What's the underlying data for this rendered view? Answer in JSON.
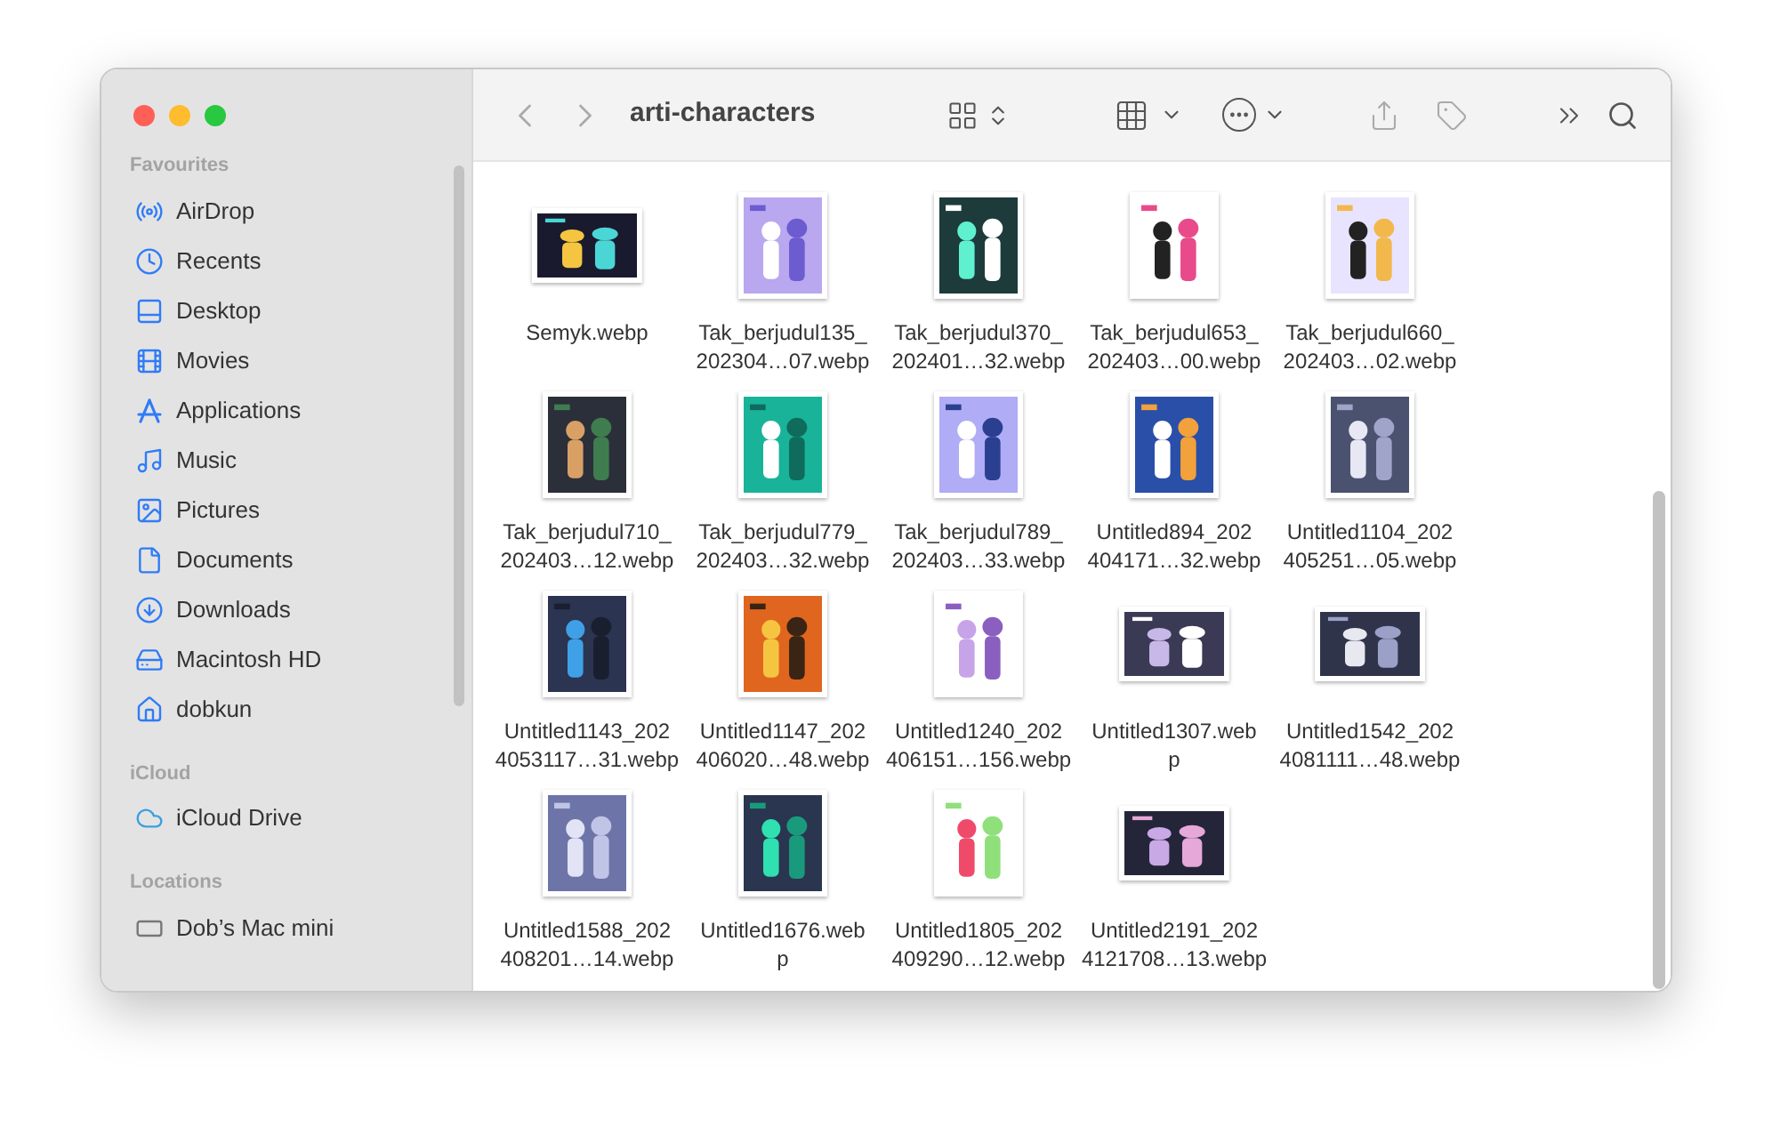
{
  "window": {
    "title": "arti-characters"
  },
  "sidebar": {
    "sections": [
      {
        "heading": "Favourites",
        "items": [
          {
            "label": "AirDrop"
          },
          {
            "label": "Recents"
          },
          {
            "label": "Desktop"
          },
          {
            "label": "Movies"
          },
          {
            "label": "Applications"
          },
          {
            "label": "Music"
          },
          {
            "label": "Pictures"
          },
          {
            "label": "Documents"
          },
          {
            "label": "Downloads"
          },
          {
            "label": "Macintosh HD"
          },
          {
            "label": "dobkun"
          }
        ]
      },
      {
        "heading": "iCloud",
        "items": [
          {
            "label": "iCloud Drive"
          }
        ]
      },
      {
        "heading": "Locations",
        "items": [
          {
            "label": "Dob’s Mac mini"
          }
        ]
      }
    ]
  },
  "files": [
    {
      "lines": [
        "Semyk.webp"
      ]
    },
    {
      "lines": [
        "Tak_berjudul135_",
        "202304…07.webp"
      ]
    },
    {
      "lines": [
        "Tak_berjudul370_",
        "202401…32.webp"
      ]
    },
    {
      "lines": [
        "Tak_berjudul653_",
        "202403…00.webp"
      ]
    },
    {
      "lines": [
        "Tak_berjudul660_",
        "202403…02.webp"
      ]
    },
    {
      "lines": [
        "Tak_berjudul710_",
        "202403…12.webp"
      ]
    },
    {
      "lines": [
        "Tak_berjudul779_",
        "202403…32.webp"
      ]
    },
    {
      "lines": [
        "Tak_berjudul789_",
        "202403…33.webp"
      ]
    },
    {
      "lines": [
        "Untitled894_202",
        "404171…32.webp"
      ]
    },
    {
      "lines": [
        "Untitled1104_202",
        "405251…05.webp"
      ]
    },
    {
      "lines": [
        "Untitled1143_202",
        "4053117…31.webp"
      ]
    },
    {
      "lines": [
        "Untitled1147_202",
        "406020…48.webp"
      ]
    },
    {
      "lines": [
        "Untitled1240_202",
        "406151…156.webp"
      ]
    },
    {
      "lines": [
        "Untitled1307.web",
        "p"
      ]
    },
    {
      "lines": [
        "Untitled1542_202",
        "4081111…48.webp"
      ]
    },
    {
      "lines": [
        "Untitled1588_202",
        "408201…14.webp"
      ]
    },
    {
      "lines": [
        "Untitled1676.web",
        "p"
      ]
    },
    {
      "lines": [
        "Untitled1805_202",
        "409290…12.webp"
      ]
    },
    {
      "lines": [
        "Untitled2191_202",
        "4121708…13.webp"
      ]
    }
  ]
}
